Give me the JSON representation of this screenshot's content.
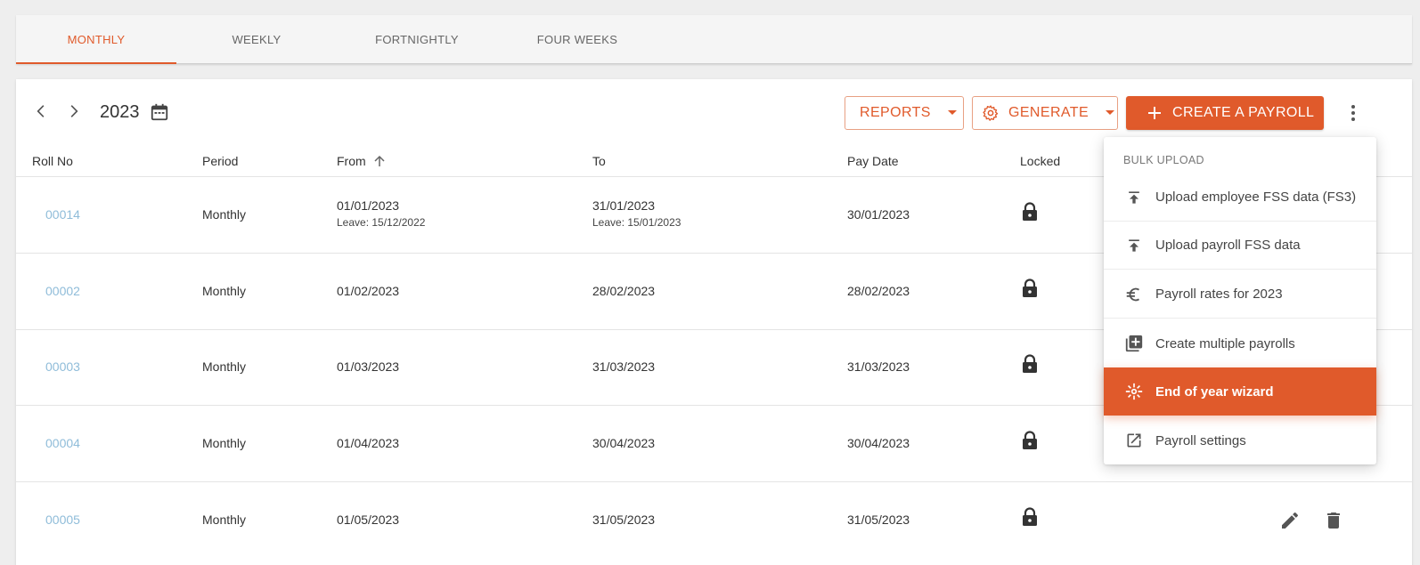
{
  "tabs": [
    "MONTHLY",
    "WEEKLY",
    "FORTNIGHTLY",
    "FOUR WEEKS"
  ],
  "toolbar": {
    "year": "2023",
    "reports_label": "REPORTS",
    "generate_label": "GENERATE",
    "create_label": "CREATE A PAYROLL"
  },
  "columns": {
    "roll_no": "Roll No",
    "period": "Period",
    "from": "From",
    "to": "To",
    "pay_date": "Pay Date",
    "locked": "Locked"
  },
  "rows": [
    {
      "roll": "00014",
      "period": "Monthly",
      "from": "01/01/2023",
      "from_leave": "Leave: 15/12/2022",
      "to": "31/01/2023",
      "to_leave": "Leave: 15/01/2023",
      "pay_date": "30/01/2023"
    },
    {
      "roll": "00002",
      "period": "Monthly",
      "from": "01/02/2023",
      "to": "28/02/2023",
      "pay_date": "28/02/2023"
    },
    {
      "roll": "00003",
      "period": "Monthly",
      "from": "01/03/2023",
      "to": "31/03/2023",
      "pay_date": "31/03/2023"
    },
    {
      "roll": "00004",
      "period": "Monthly",
      "from": "01/04/2023",
      "to": "30/04/2023",
      "pay_date": "30/04/2023"
    },
    {
      "roll": "00005",
      "period": "Monthly",
      "from": "01/05/2023",
      "to": "31/05/2023",
      "pay_date": "31/05/2023"
    }
  ],
  "menu": {
    "header": "BULK UPLOAD",
    "items": [
      {
        "label": "Upload employee FSS data (FS3)",
        "icon": "upload-icon"
      },
      {
        "label": "Upload payroll FSS data",
        "icon": "upload-icon"
      },
      {
        "label": "Payroll rates for 2023",
        "icon": "euro-icon"
      },
      {
        "label": "Create multiple payrolls",
        "icon": "library-add-icon"
      },
      {
        "label": "End of year wizard",
        "icon": "wizard-icon"
      },
      {
        "label": "Payroll settings",
        "icon": "open-in-new-icon"
      }
    ]
  },
  "colors": {
    "accent": "#e05a2b",
    "link": "#8fbcd9"
  }
}
